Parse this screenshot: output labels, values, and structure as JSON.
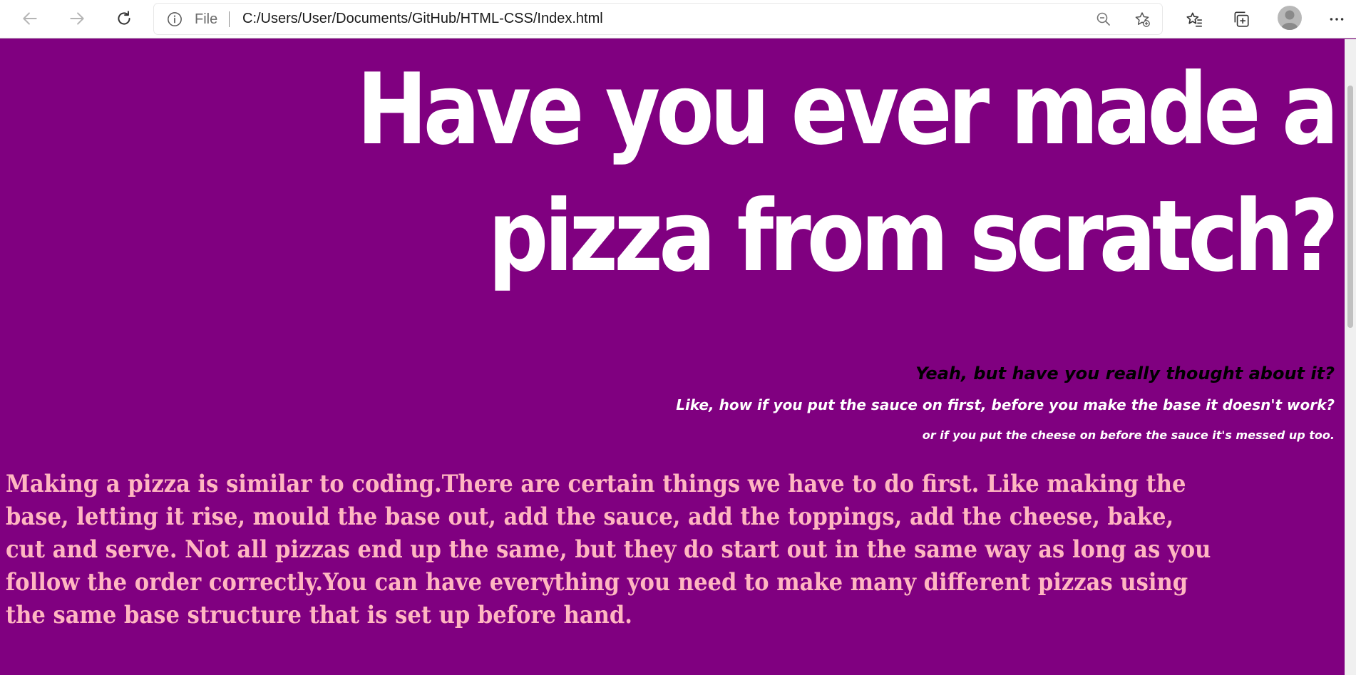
{
  "browser": {
    "scheme_label": "File",
    "url": "C:/Users/User/Documents/GitHub/HTML-CSS/Index.html",
    "icons": {
      "back": "back-arrow-icon",
      "forward": "forward-arrow-icon",
      "refresh": "refresh-icon",
      "info": "info-icon",
      "zoom": "zoom-out-icon",
      "add_favorite": "add-favorite-star-icon",
      "favorites": "favorites-icon",
      "collections": "collections-icon",
      "profile": "profile-avatar",
      "more": "more-dots-icon"
    }
  },
  "page": {
    "background_color": "#800080",
    "headline": "Have you ever made a pizza from scratch?",
    "sub_heading_1": "Yeah, but have you really thought about it?",
    "sub_heading_2": "Like, how if you put the sauce on first, before you make the base it doesn't work?",
    "sub_heading_3": "or if you put the cheese on before the sauce it's messed up too.",
    "paragraph": "Making a pizza is similar to coding.There are certain things we have to do first. Like making the base, letting it rise, mould the base out, add the sauce, add the toppings, add the cheese, bake, cut and serve. Not all pizzas end up the same, but they do start out in the same way as long as you follow the order correctly.You can have everything you need to make many different pizzas using the same base structure that is set up before hand.",
    "colors": {
      "headline": "#ffffff",
      "sub_heading_1": "#000000",
      "sub_headings_other": "#ffffff",
      "paragraph": "#ffb6c1"
    }
  }
}
